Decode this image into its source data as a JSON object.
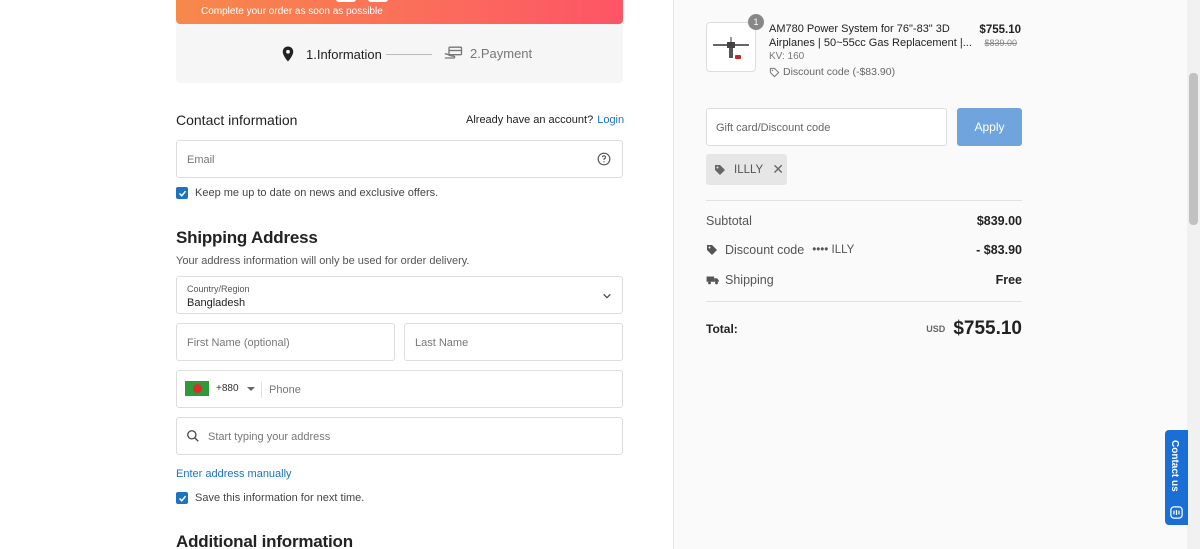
{
  "banner": {
    "text": "Complete your order as soon as possible"
  },
  "steps": {
    "step1": "1.Information",
    "step2": "2.Payment"
  },
  "contact": {
    "title": "Contact information",
    "account_prompt": "Already have an account?",
    "login_link": "Login",
    "email_placeholder": "Email",
    "newsletter_label": "Keep me up to date on news and exclusive offers."
  },
  "shipping": {
    "title": "Shipping Address",
    "subtitle": "Your address information will only be used for order delivery.",
    "country_label": "Country/Region",
    "country_value": "Bangladesh",
    "first_name_placeholder": "First Name (optional)",
    "last_name_placeholder": "Last Name",
    "phone_code": "+880",
    "phone_placeholder": "Phone",
    "address_placeholder": "Start typing your address",
    "manual_link": "Enter address manually",
    "save_label": "Save this information for next time."
  },
  "additional": {
    "title": "Additional information"
  },
  "summary": {
    "product": {
      "quantity": "1",
      "title": "AM780 Power System for 76\"-83\" 3D Airplanes | 50~55cc Gas Replacement |...",
      "variant": "KV: 160",
      "discount": "Discount code (-$83.90)",
      "price": "$755.10",
      "original_price": "$839.00"
    },
    "gift_placeholder": "Gift card/Discount code",
    "apply_label": "Apply",
    "applied_code": "ILLLY",
    "subtotal_label": "Subtotal",
    "subtotal_value": "$839.00",
    "discount_label": "Discount code",
    "discount_code_masked": "•••• ILLY",
    "discount_value": "- $83.90",
    "shipping_label": "Shipping",
    "shipping_value": "Free",
    "total_label": "Total:",
    "currency": "USD",
    "total_value": "$755.10"
  },
  "contact_us": {
    "label": "Contact us"
  },
  "colors": {
    "accent": "#1a73c8",
    "apply_button": "#6fa5dc",
    "banner_start": "#f7894a",
    "banner_end": "#fd5466",
    "contact_tab": "#1a6fd6"
  }
}
